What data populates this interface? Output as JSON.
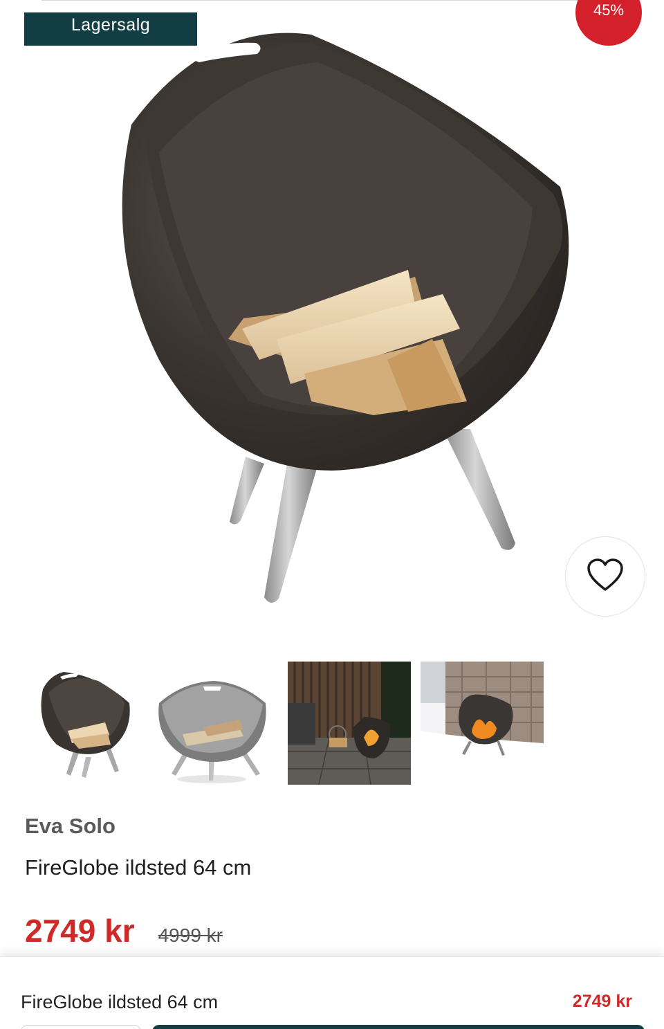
{
  "badges": {
    "stock_sale": "Lagersalg",
    "discount": "45%"
  },
  "icons": {
    "favorite": "heart-outline-icon"
  },
  "colors": {
    "brand_dark": "#123e43",
    "sale_red": "#cf2a2a",
    "discount_badge": "#d4202a"
  },
  "gallery": {
    "thumbnails": [
      {
        "label": "product-black-with-logs"
      },
      {
        "label": "product-steel-with-logs"
      },
      {
        "label": "product-terrace-evening"
      },
      {
        "label": "product-snow-outdoor"
      }
    ]
  },
  "product": {
    "brand": "Eva Solo",
    "title": "FireGlobe ildsted 64 cm",
    "price": "2749 kr",
    "original_price": "4999 kr"
  },
  "sticky_bar": {
    "title": "FireGlobe ildsted 64 cm",
    "price": "2749 kr"
  }
}
